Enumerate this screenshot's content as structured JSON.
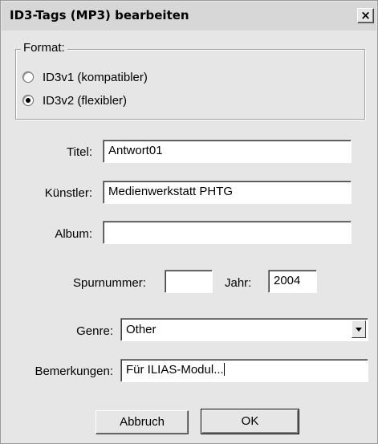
{
  "window": {
    "title": "ID3-Tags (MP3) bearbeiten",
    "close_label": "×"
  },
  "format": {
    "legend": "Format:",
    "options": [
      {
        "label": "ID3v1 (kompatibler)",
        "selected": false
      },
      {
        "label": "ID3v2 (flexibler)",
        "selected": true
      }
    ]
  },
  "fields": {
    "titel": {
      "label": "Titel:",
      "value": "Antwort01"
    },
    "kuenstler": {
      "label": "Künstler:",
      "value": "Medienwerkstatt PHTG"
    },
    "album": {
      "label": "Album:",
      "value": ""
    },
    "spurnummer": {
      "label": "Spurnummer:",
      "value": ""
    },
    "jahr": {
      "label": "Jahr:",
      "value": "2004"
    },
    "genre": {
      "label": "Genre:",
      "value": "Other"
    },
    "bemerkungen": {
      "label": "Bemerkungen:",
      "value": "Für ILIAS-Modul..."
    }
  },
  "buttons": {
    "cancel": "Abbruch",
    "ok": "OK"
  },
  "icons": {
    "close": "close-icon",
    "dropdown": "chevron-down-icon"
  }
}
